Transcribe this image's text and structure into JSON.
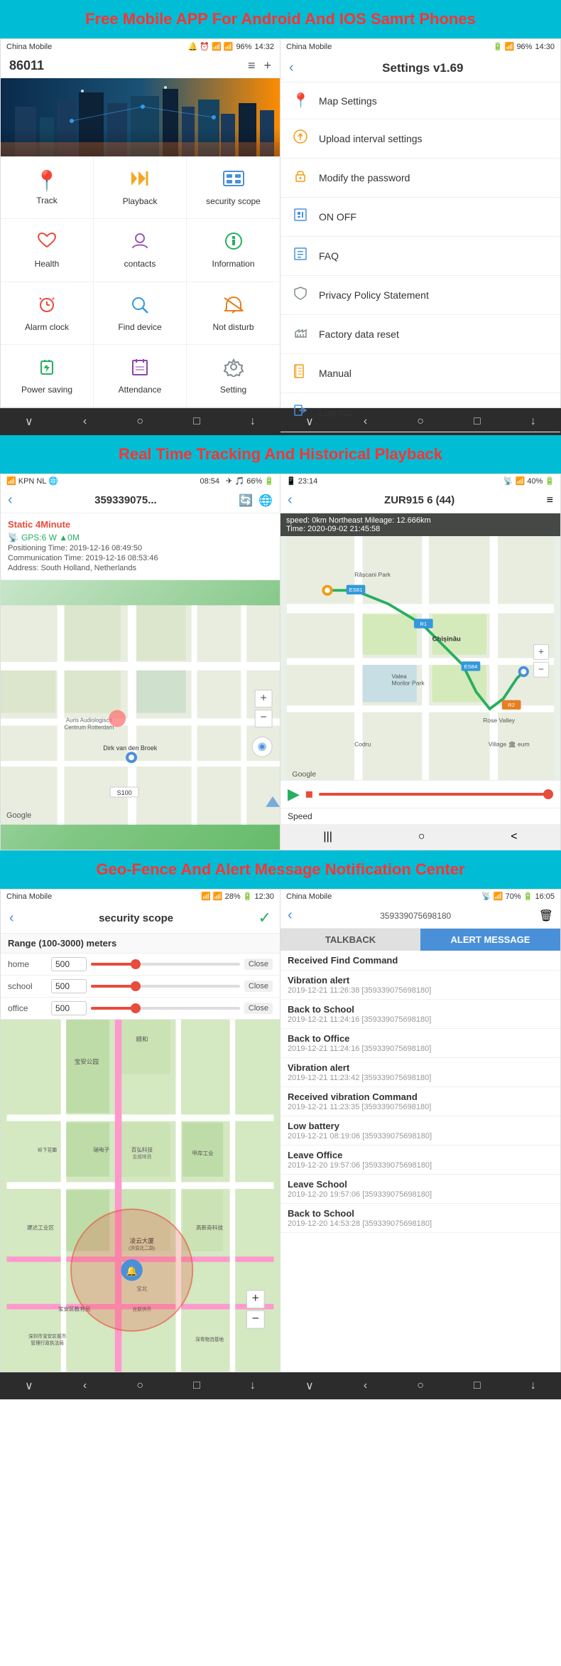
{
  "banner1": {
    "text": "Free Mobile APP For Android And IOS Samrt Phones"
  },
  "banner2": {
    "text": "Real Time Tracking And Historical Playback"
  },
  "banner3": {
    "text": "Geo-Fence And Alert Message Notification Center"
  },
  "phone_left": {
    "status": {
      "carrier": "China Mobile",
      "time": "14:32",
      "battery": "96%"
    },
    "header": {
      "number": "86011"
    },
    "menu_items": [
      {
        "label": "Track",
        "icon": "📍"
      },
      {
        "label": "Playback",
        "icon": "⏮"
      },
      {
        "label": "security scope",
        "icon": "🔷"
      },
      {
        "label": "Health",
        "icon": "❤️"
      },
      {
        "label": "contacts",
        "icon": "👤"
      },
      {
        "label": "Information",
        "icon": "💬"
      },
      {
        "label": "Alarm clock",
        "icon": "⏰"
      },
      {
        "label": "Find device",
        "icon": "🔍"
      },
      {
        "label": "Not disturb",
        "icon": "🔔"
      },
      {
        "label": "Power saving",
        "icon": "⚡"
      },
      {
        "label": "Attendance",
        "icon": "📋"
      },
      {
        "label": "Setting",
        "icon": "⚙️"
      }
    ]
  },
  "phone_right": {
    "status": {
      "carrier": "China Mobile",
      "time": "14:30"
    },
    "header": {
      "title": "Settings v1.69"
    },
    "settings_items": [
      {
        "label": "Map Settings",
        "icon": "📍"
      },
      {
        "label": "Upload interval settings",
        "icon": "⬆️"
      },
      {
        "label": "Modify the password",
        "icon": "🔒"
      },
      {
        "label": "ON OFF",
        "icon": "🔲"
      },
      {
        "label": "FAQ",
        "icon": "🔲"
      },
      {
        "label": "Privacy Policy Statement",
        "icon": "🛡️"
      },
      {
        "label": "Factory data reset",
        "icon": "🔧"
      },
      {
        "label": "Manual",
        "icon": "📖"
      },
      {
        "label": "Log out",
        "icon": "🚪"
      }
    ]
  },
  "map_left": {
    "status": {
      "carrier": "KPN NL",
      "time": "08:54",
      "battery": "66%"
    },
    "device_id": "359339075...",
    "static_label": "Static 4Minute",
    "gps_info": "GPS:6 W  ▲0M",
    "pos_time": "Positioning Time: 2019-12-16 08:49:50",
    "comm_time": "Communication Time: 2019-12-16 08:53:46",
    "address": "Address: South Holland, Netherlands",
    "google_label": "Google"
  },
  "map_right": {
    "status": {
      "carrier": "23:14",
      "battery": "40%"
    },
    "device_name": "ZUR915 6 (44)",
    "speed_info": "speed: 0km  Northeast  Mileage: 12.666km",
    "time_info": "Time: 2020-09-02 21:45:58",
    "speed_label": "Speed",
    "google_label": "Google"
  },
  "geo_left": {
    "status": {
      "carrier": "China Mobile",
      "time": "12:30"
    },
    "title": "security scope",
    "range_label": "Range (100-3000) meters",
    "fences": [
      {
        "name": "home",
        "value": "500"
      },
      {
        "name": "school",
        "value": "500"
      },
      {
        "name": "office",
        "value": "500"
      }
    ]
  },
  "geo_right": {
    "status": {
      "carrier": "China Mobile",
      "time": "16:05"
    },
    "device_id": "359339075698180",
    "tabs": [
      "TALKBACK",
      "ALERT MESSAGE"
    ],
    "alerts": [
      {
        "msg": "Received Find Command",
        "time": ""
      },
      {
        "msg": "Vibration alert",
        "time": "2019-12-21 11:26:38  [359339075698180]"
      },
      {
        "msg": "Back to School",
        "time": "2019-12-21 11:24:16  [359339075698180]"
      },
      {
        "msg": "Back to Office",
        "time": "2019-12-21 11:24:16  [359339075698180]"
      },
      {
        "msg": "Vibration alert",
        "time": "2019-12-21 11:23:42  [359339075698180]"
      },
      {
        "msg": "Received vibration Command",
        "time": "2019-12-21 11:23:35  [359339075698180]"
      },
      {
        "msg": "Low battery",
        "time": "2019-12-21 08:19:06  [359339075698180]"
      },
      {
        "msg": "Leave Office",
        "time": "2019-12-20 19:57:06  [359339075698180]"
      },
      {
        "msg": "Leave School",
        "time": "2019-12-20 19:57:06  [359339075698180]"
      },
      {
        "msg": "Back to School",
        "time": "2019-12-20 14:53:28  [359339075698180]"
      }
    ]
  },
  "nav": {
    "back": "‹",
    "home": "○",
    "square": "□",
    "menu": "≡",
    "chevron": "∨"
  }
}
